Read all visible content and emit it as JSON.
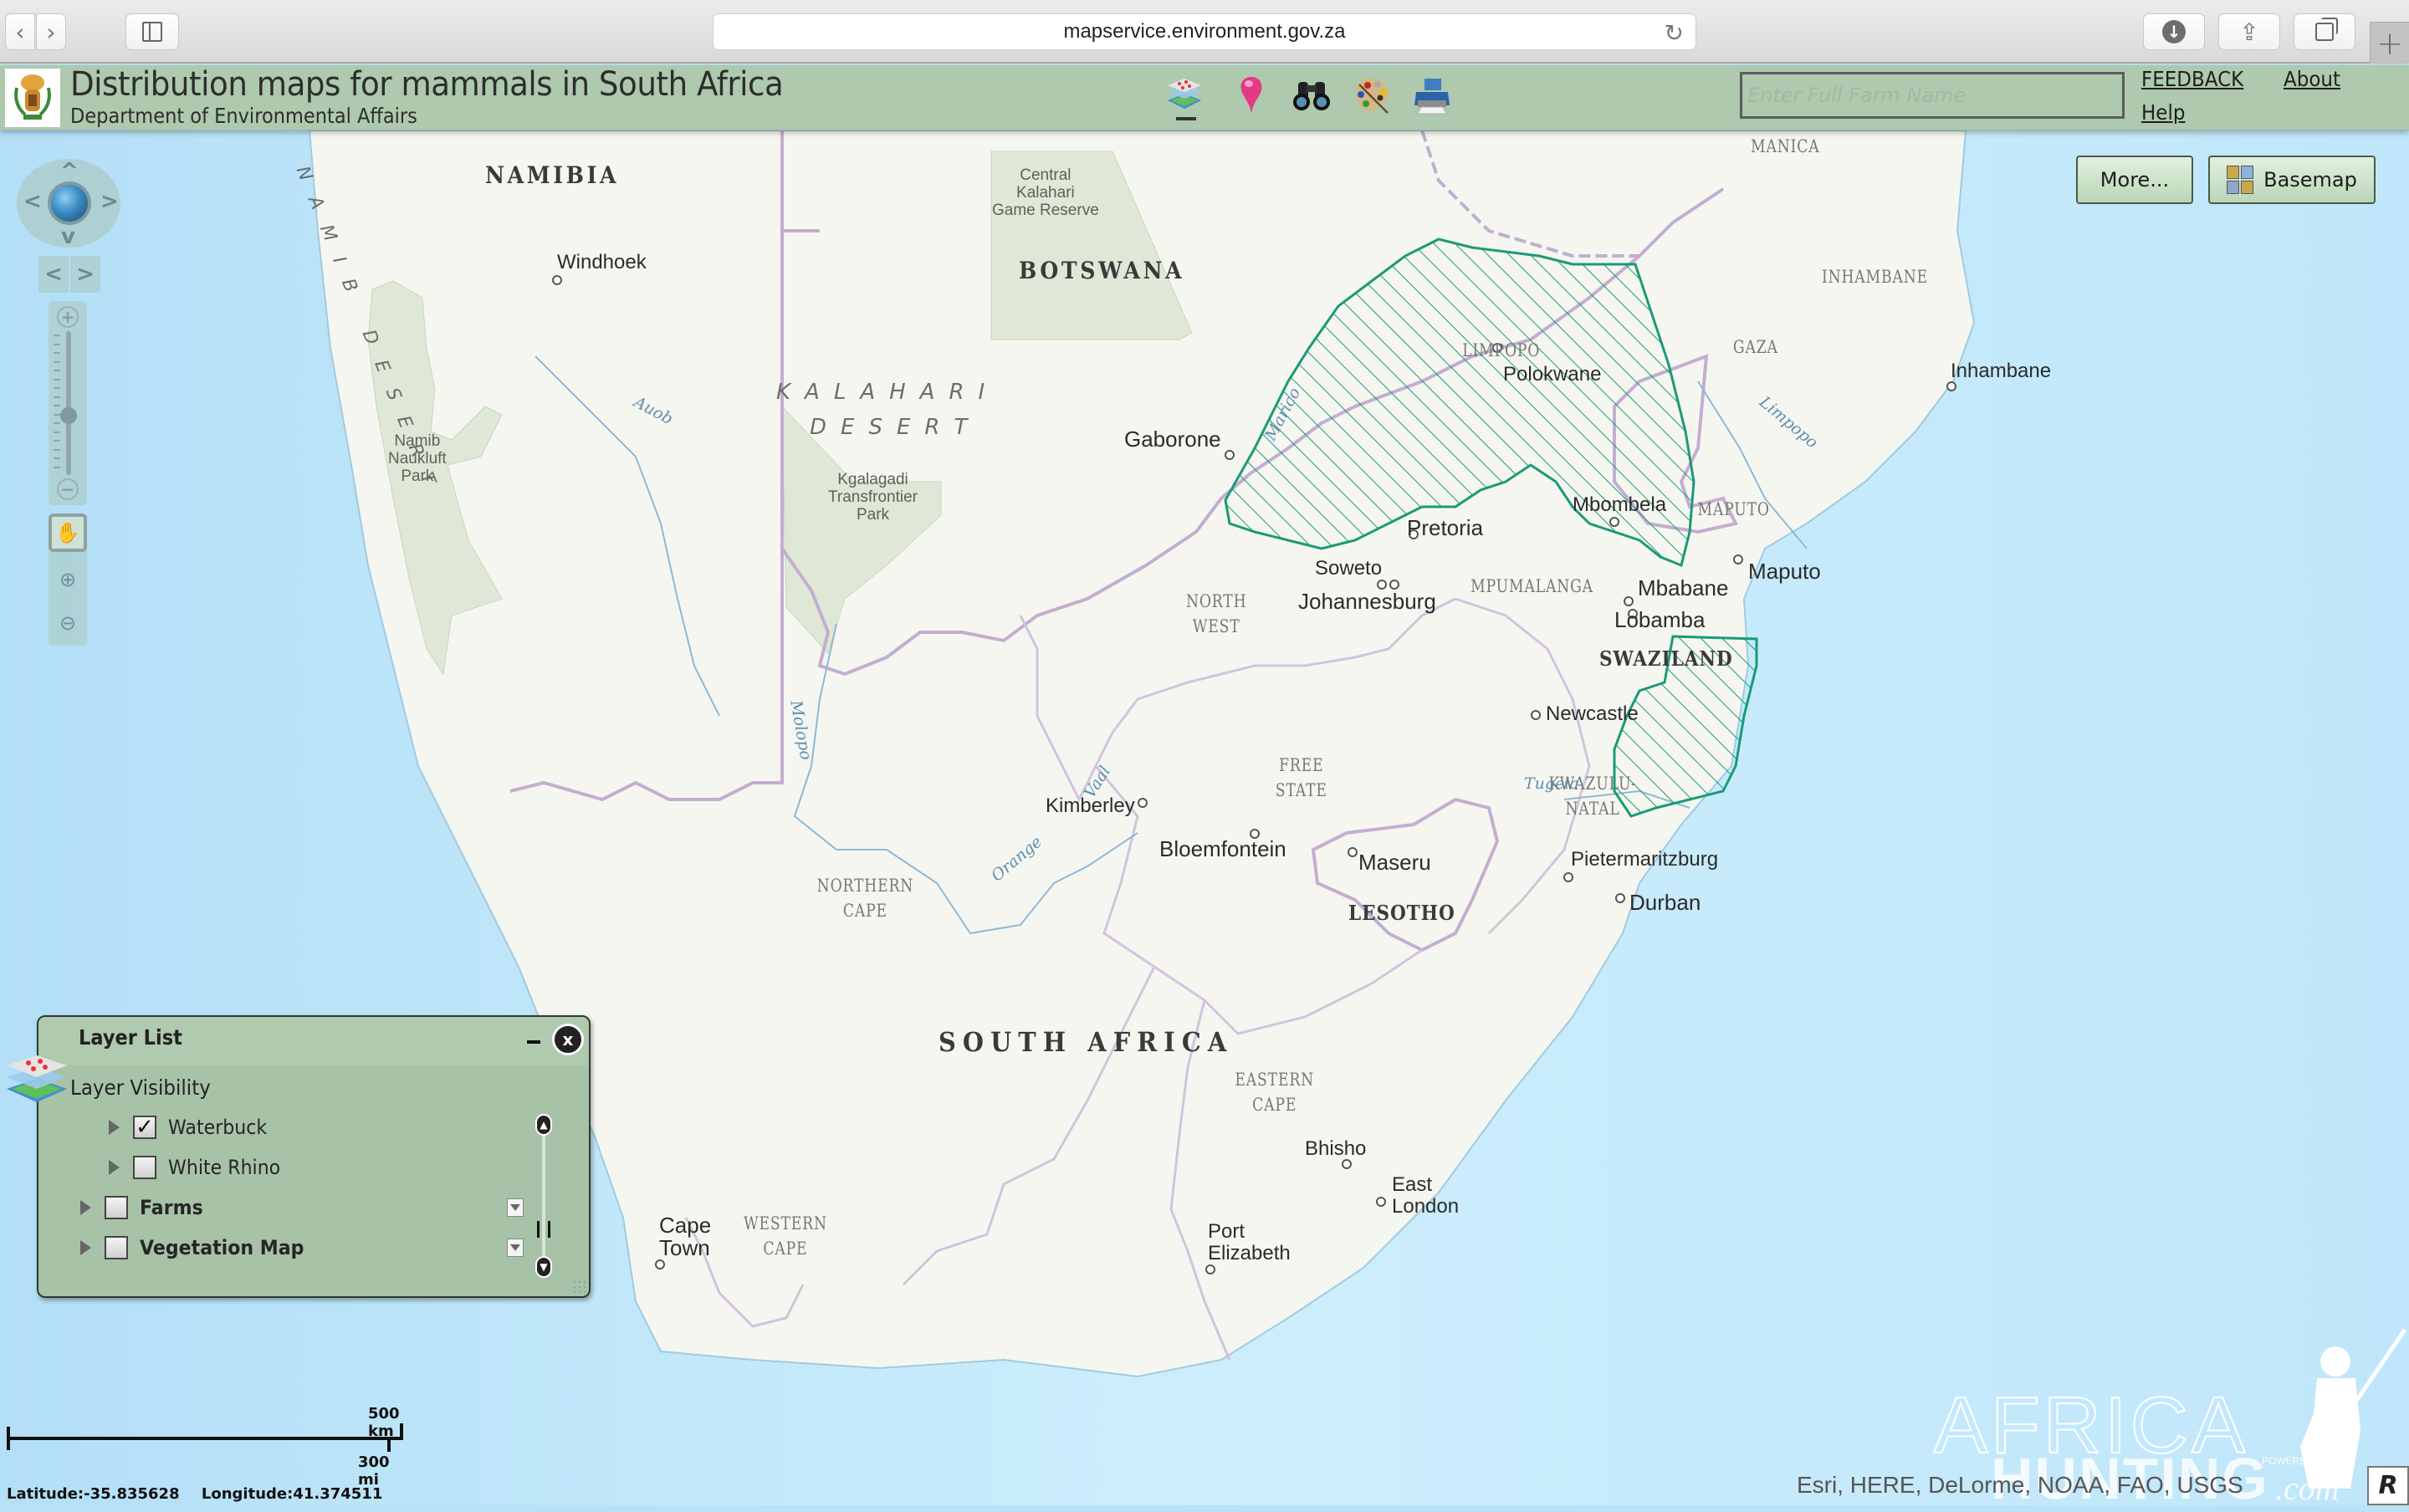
{
  "browser": {
    "url": "mapservice.environment.gov.za",
    "back_icon": "‹",
    "forward_icon": "›",
    "reload_icon": "↻",
    "download_icon": "↓",
    "share_icon": "⇪",
    "newtab_icon": "+"
  },
  "header": {
    "title": "Distribution maps for mammals in South Africa",
    "subtitle": "Department of Environmental Affairs",
    "search_placeholder": "Enter Full Farm Name",
    "search_value": "",
    "links": {
      "feedback": "FEEDBACK",
      "about": "About",
      "help": "Help"
    },
    "tools": [
      {
        "name": "layers-tool",
        "icon": "layers-icon",
        "active": true
      },
      {
        "name": "pin-tool",
        "icon": "map-pin-icon",
        "active": false
      },
      {
        "name": "binoculars-tool",
        "icon": "binoculars-icon",
        "active": false
      },
      {
        "name": "palette-tool",
        "icon": "palette-icon",
        "active": false
      },
      {
        "name": "print-tool",
        "icon": "printer-icon",
        "active": false
      }
    ]
  },
  "map_buttons": {
    "more": "More...",
    "basemap": "Basemap"
  },
  "navigation": {
    "pan_up": "^",
    "pan_down": "v",
    "pan_left": "<",
    "pan_right": ">",
    "prev_extent": "<",
    "next_extent": ">",
    "zoom_in": "+",
    "zoom_out": "−",
    "zoom_level_fraction": 0.43,
    "pan_tool": "✋",
    "zoom_in_tool": "⊕",
    "zoom_out_tool": "⊖"
  },
  "layer_list": {
    "title": "Layer List",
    "section": "Layer Visibility",
    "close": "x",
    "layers": [
      {
        "name": "Waterbuck",
        "checked": true,
        "bold": false,
        "level": 1,
        "check_mark": "✓"
      },
      {
        "name": "White Rhino",
        "checked": false,
        "bold": false,
        "level": 1,
        "check_mark": ""
      },
      {
        "name": "Farms",
        "checked": false,
        "bold": true,
        "level": 0,
        "check_mark": ""
      },
      {
        "name": "Vegetation Map",
        "checked": false,
        "bold": true,
        "level": 0,
        "check_mark": ""
      }
    ],
    "scroll_up": "▲",
    "scroll_down": "▼"
  },
  "map_labels": {
    "countries": [
      "NAMIBIA",
      "BOTSWANA",
      "SOUTH AFRICA",
      "LESOTHO",
      "SWAZILAND"
    ],
    "provinces": [
      "LIMPOPO",
      "NORTH\nWEST",
      "MPUMALANGA",
      "FREE\nSTATE",
      "NORTHERN\nCAPE",
      "EASTERN\nCAPE",
      "WESTERN\nCAPE",
      "KWAZULU-\nNATAL",
      "GAZA",
      "INHAMBANE",
      "MAPUTO",
      "MANICA"
    ],
    "cities": [
      "Windhoek",
      "Gaborone",
      "Polokwane",
      "Pretoria",
      "Soweto",
      "Johannesburg",
      "Mbombela",
      "Mbabane",
      "Lobamba",
      "Maputo",
      "Inhambane",
      "Newcastle",
      "Kimberley",
      "Bloemfontein",
      "Maseru",
      "Pietermaritzburg",
      "Durban",
      "Cape\nTown",
      "Port\nElizabeth",
      "East\nLondon",
      "Bhisho"
    ],
    "parks": [
      "Central\nKalahari\nGame Reserve",
      "Kgalagadi\nTransfrontier\nPark",
      "Namib\nNaukluft\nPark"
    ],
    "deserts": [
      "KALAHARI",
      "DESERT",
      "NAMIB DESERT"
    ],
    "rivers": [
      "Auob",
      "Molopo",
      "Orange",
      "Vaal",
      "Marico",
      "Limpopo",
      "Tugela"
    ]
  },
  "distribution_layer": {
    "species": "Waterbuck",
    "color": "#1a9a78",
    "hatch": "diagonal"
  },
  "scale": {
    "km": "500 km",
    "mi": "300 mi"
  },
  "coordinates": {
    "latitude": "Latitude:-35.835628",
    "longitude": "Longitude:41.374511"
  },
  "attribution": "Esri, HERE, DeLorme, NOAA, FAO, USGS",
  "watermark": {
    "line1": "AFRICA",
    "line2": "HUNTING",
    "suffix": ".com",
    "powered": "POWERED BY"
  },
  "colors": {
    "header_bg": "#aec9ad",
    "ocean": "#b9e2f7",
    "land": "#f6f6f1",
    "park": "#dfe8d6",
    "border": "#c7b3cf",
    "distribution": "#1a9a78"
  }
}
